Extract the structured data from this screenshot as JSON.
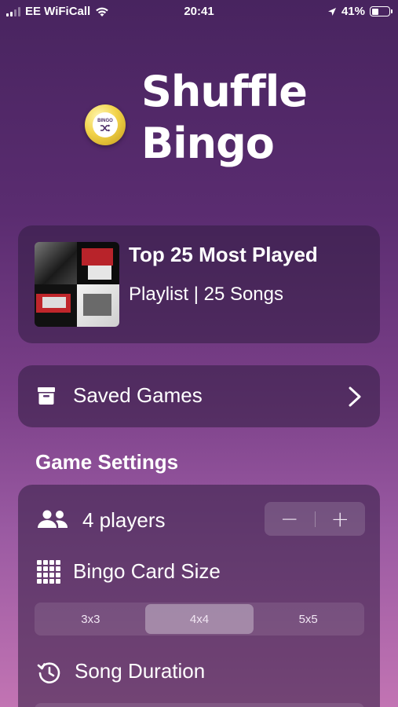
{
  "status_bar": {
    "carrier": "EE WiFiCall",
    "time": "20:41",
    "battery_percent": "41%",
    "battery_level": 0.41,
    "signal_bars": 2
  },
  "app": {
    "title_line1": "Shuffle",
    "title_line2": "Bingo",
    "logo_text": "BINGO"
  },
  "playlist": {
    "title": "Top 25 Most Played",
    "subtitle": "Playlist | 25 Songs"
  },
  "saved_games": {
    "label": "Saved Games"
  },
  "game_settings": {
    "header": "Game Settings",
    "players_label": "4 players",
    "decrement_label": "−",
    "increment_label": "+",
    "card_size_label": "Bingo Card Size",
    "card_size_options": [
      "3x3",
      "4x4",
      "5x5"
    ],
    "card_size_selected": "4x4",
    "song_duration_label": "Song Duration"
  }
}
